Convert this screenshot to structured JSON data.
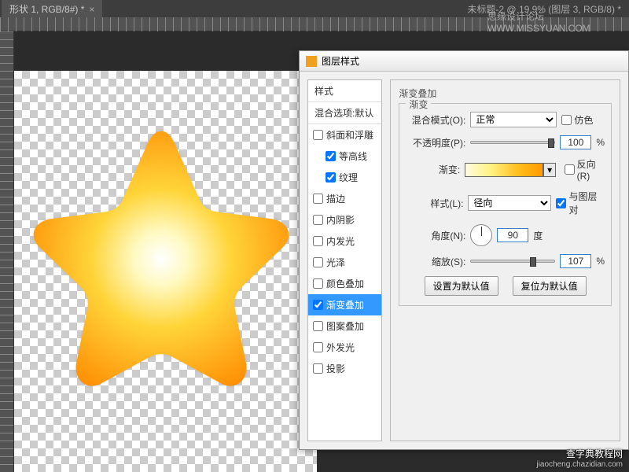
{
  "tabs": {
    "active": "形状 1, RGB/8#) *",
    "inactive": "未标题-2 @ 19.9% (图层 3, RGB/8) *"
  },
  "watermark": {
    "top_logo": "思缘设计论坛",
    "top_url": "WWW.MISSYUAN.COM",
    "bottom_title": "查字典教程网",
    "bottom_url": "jiaocheng.chazidian.com"
  },
  "dialog": {
    "title": "图层样式",
    "styles_header": "样式",
    "blend_options": "混合选项:默认",
    "style_items": [
      {
        "label": "斜面和浮雕",
        "checked": false,
        "indent": false
      },
      {
        "label": "等高线",
        "checked": true,
        "indent": true
      },
      {
        "label": "纹理",
        "checked": true,
        "indent": true
      },
      {
        "label": "描边",
        "checked": false,
        "indent": false
      },
      {
        "label": "内阴影",
        "checked": false,
        "indent": false
      },
      {
        "label": "内发光",
        "checked": false,
        "indent": false
      },
      {
        "label": "光泽",
        "checked": false,
        "indent": false
      },
      {
        "label": "颜色叠加",
        "checked": false,
        "indent": false
      },
      {
        "label": "渐变叠加",
        "checked": true,
        "indent": false,
        "selected": true
      },
      {
        "label": "图案叠加",
        "checked": false,
        "indent": false
      },
      {
        "label": "外发光",
        "checked": false,
        "indent": false
      },
      {
        "label": "投影",
        "checked": false,
        "indent": false
      }
    ],
    "panel": {
      "group_title": "渐变叠加",
      "legend": "渐变",
      "blend_mode_label": "混合模式(O):",
      "blend_mode_value": "正常",
      "dither_label": "仿色",
      "opacity_label": "不透明度(P):",
      "opacity_value": "100",
      "gradient_label": "渐变:",
      "reverse_label": "反向(R)",
      "style_label": "样式(L):",
      "style_value": "径向",
      "align_label": "与图层对",
      "align_checked": true,
      "angle_label": "角度(N):",
      "angle_value": "90",
      "angle_unit": "度",
      "scale_label": "缩放(S):",
      "scale_value": "107",
      "percent": "%",
      "btn_default": "设置为默认值",
      "btn_reset": "复位为默认值"
    }
  }
}
